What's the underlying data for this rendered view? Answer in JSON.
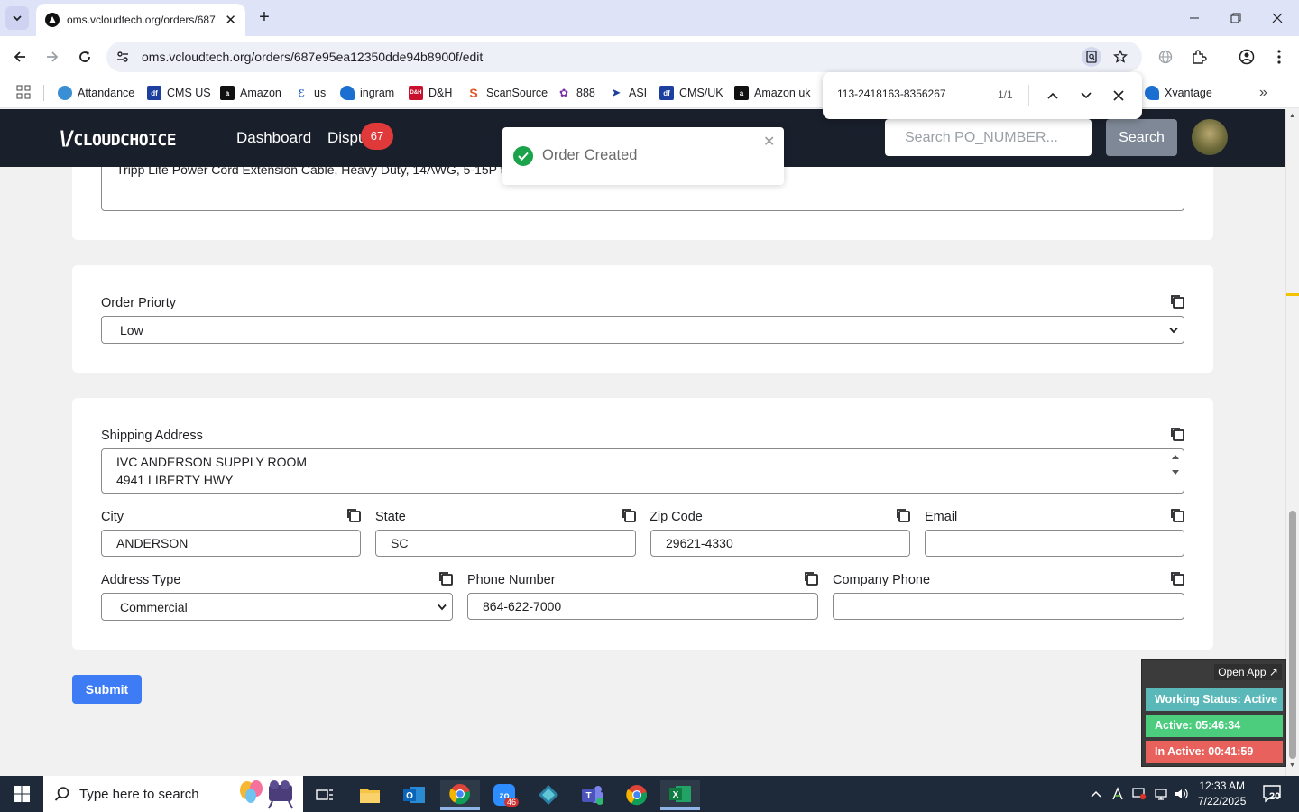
{
  "browser": {
    "tab_title": "oms.vcloudtech.org/orders/687",
    "url": "oms.vcloudtech.org/orders/687e95ea12350dde94b8900f/edit",
    "bookmarks": [
      "Attandance",
      "CMS US",
      "Amazon",
      "us",
      "ingram",
      "D&H",
      "ScanSource",
      "888",
      "ASI",
      "CMS/UK",
      "Amazon uk",
      "Xvantage"
    ],
    "find": {
      "query": "113-2418163-8356267",
      "count": "1/1"
    }
  },
  "header": {
    "logo": "CLOUDCHOICE",
    "nav": [
      "Dashboard",
      "Dispu"
    ],
    "badge": "67",
    "search_placeholder": "Search PO_NUMBER...",
    "search_button": "Search"
  },
  "toast": {
    "message": "Order Created"
  },
  "form": {
    "description": "Tripp Lite Power Cord Extension Cable, Heavy Duty, 14AWG, 5-15P to",
    "order_priority": {
      "label": "Order Priorty",
      "value": "Low"
    },
    "shipping_address": {
      "label": "Shipping Address",
      "line1": "IVC ANDERSON SUPPLY ROOM",
      "line2": "4941 LIBERTY HWY"
    },
    "city": {
      "label": "City",
      "value": "ANDERSON"
    },
    "state": {
      "label": "State",
      "value": "SC"
    },
    "zip": {
      "label": "Zip Code",
      "value": "29621-4330"
    },
    "email": {
      "label": "Email",
      "value": ""
    },
    "address_type": {
      "label": "Address Type",
      "value": "Commercial"
    },
    "phone": {
      "label": "Phone Number",
      "value": "864-622-7000"
    },
    "company_phone": {
      "label": "Company Phone",
      "value": ""
    },
    "submit": "Submit"
  },
  "status_widget": {
    "open_app": "Open App ↗",
    "working": "Working Status: Active",
    "active": "Active: 05:46:34",
    "inactive": "In Active: 00:41:59"
  },
  "taskbar": {
    "search_placeholder": "Type here to search",
    "zoom_badge": "46",
    "time": "12:33 AM",
    "date": "7/22/2025",
    "notifications": "20"
  },
  "colors": {
    "header_bg": "#1a1f2c",
    "badge": "#e0393a",
    "submit": "#3d7cf5",
    "status_active": "#4ccd7e",
    "status_inactive": "#e8615c",
    "status_working": "#5bb8b8"
  }
}
